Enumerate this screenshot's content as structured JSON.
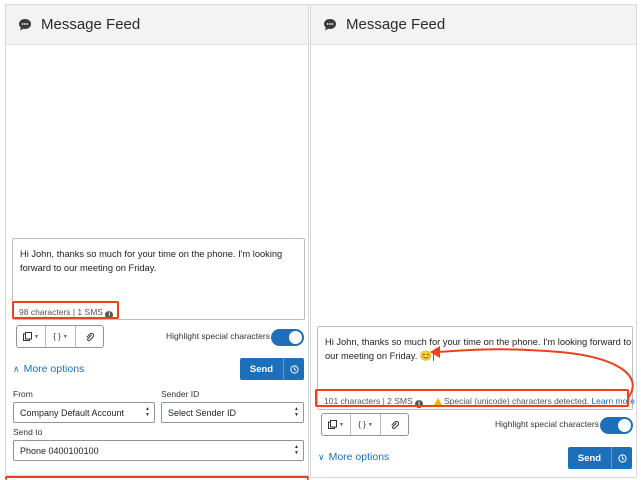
{
  "left": {
    "header": {
      "title": "Message Feed",
      "icon": "chat-icon"
    },
    "message": {
      "line1": "Hi John, thanks so much for your time on the phone. I'm looking",
      "line2": "forward to our meeting on Friday."
    },
    "counter": {
      "text": "98 characters | 1 SMS"
    },
    "toolbar": {
      "braces": "{ }"
    },
    "highlight_label": "Highlight special characters",
    "highlight_on": true,
    "more_options": "More options",
    "send_label": "Send",
    "form": {
      "from_label": "From",
      "from_value": "Company Default Account",
      "sender_label": "Sender ID",
      "sender_value": "Select Sender ID",
      "sendto_label": "Send to",
      "sendto_value": "Phone 0400100100"
    }
  },
  "right": {
    "header": {
      "title": "Message Feed",
      "icon": "chat-icon"
    },
    "message": {
      "line1": "Hi John, thanks so much for your time on the phone. I'm looking forward to",
      "line2": "our meeting on Friday.",
      "emoji": "😊"
    },
    "counter": {
      "text": "101 characters | 2 SMS"
    },
    "warning": {
      "text": "Special (unicode) characters detected.",
      "link": "Learn more"
    },
    "toolbar": {
      "braces": "{ }"
    },
    "highlight_label": "Highlight special characters",
    "highlight_on": true,
    "more_options": "More options",
    "send_label": "Send"
  },
  "colors": {
    "accent": "#1c6fb8",
    "highlight_annotation": "#e8431e",
    "warning": "#f0b400"
  }
}
